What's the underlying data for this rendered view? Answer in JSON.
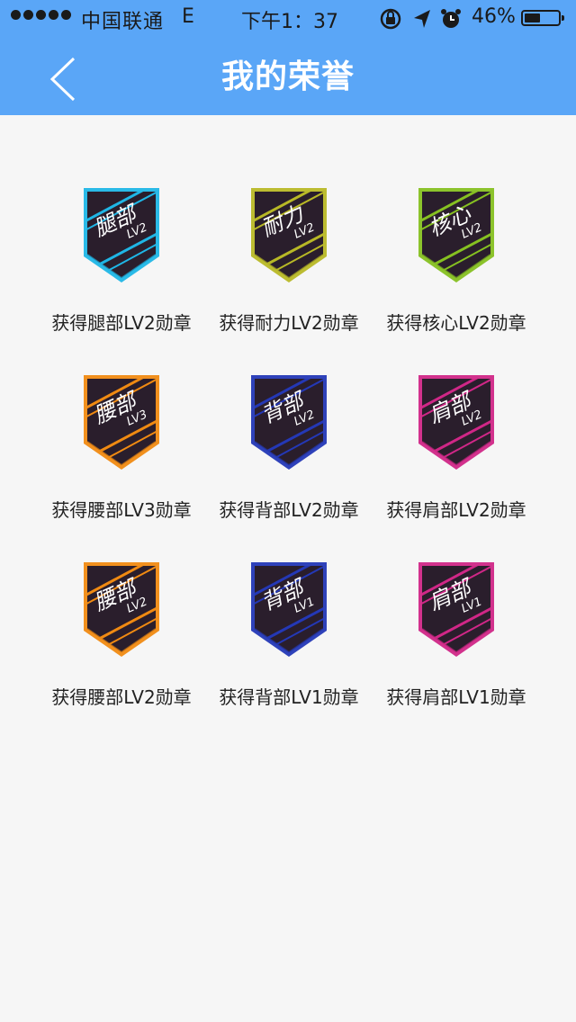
{
  "status_bar": {
    "carrier": "中国联通",
    "network": "E",
    "time": "下午1：37",
    "battery_percent": "46%",
    "icons": [
      "rotation-lock-icon",
      "location-arrow-icon",
      "alarm-clock-icon",
      "battery-icon"
    ]
  },
  "nav": {
    "back_icon": "chevron-left-icon",
    "title": "我的荣誉"
  },
  "badges": [
    {
      "name": "腿部",
      "level": "LV2",
      "label": "获得腿部LV2勋章",
      "color": "#1fb6e6"
    },
    {
      "name": "耐力",
      "level": "LV2",
      "label": "获得耐力LV2勋章",
      "color": "#b8b826"
    },
    {
      "name": "核心",
      "level": "LV2",
      "label": "获得核心LV2勋章",
      "color": "#86c021"
    },
    {
      "name": "腰部",
      "level": "LV3",
      "label": "获得腰部LV3勋章",
      "color": "#f08a12"
    },
    {
      "name": "背部",
      "level": "LV2",
      "label": "获得背部LV2勋章",
      "color": "#2438b6"
    },
    {
      "name": "肩部",
      "level": "LV2",
      "label": "获得肩部LV2勋章",
      "color": "#d02787"
    },
    {
      "name": "腰部",
      "level": "LV2",
      "label": "获得腰部LV2勋章",
      "color": "#f08a12"
    },
    {
      "name": "背部",
      "level": "LV1",
      "label": "获得背部LV1勋章",
      "color": "#2438b6"
    },
    {
      "name": "肩部",
      "level": "LV1",
      "label": "获得肩部LV1勋章",
      "color": "#d02787"
    }
  ]
}
